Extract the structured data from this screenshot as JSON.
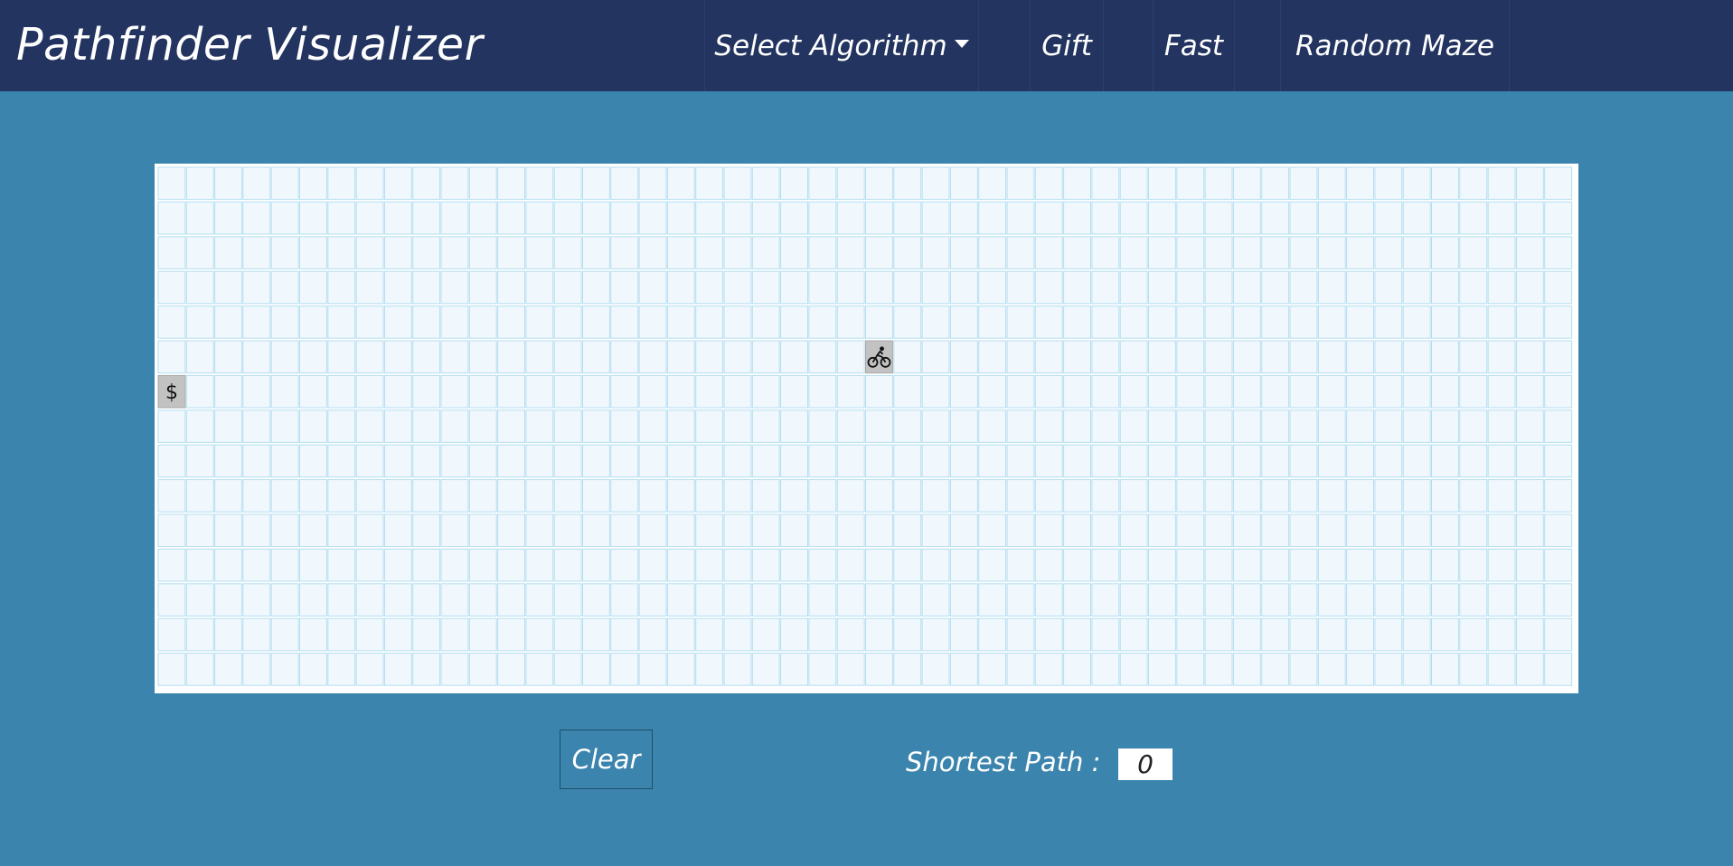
{
  "app": {
    "title": "Pathfinder Visualizer"
  },
  "nav": {
    "select_algorithm": "Select Algorithm",
    "gift": "Gift",
    "fast": "Fast",
    "random_maze": "Random Maze"
  },
  "grid": {
    "rows": 15,
    "cols": 50,
    "start_node": {
      "row": 5,
      "col": 25,
      "icon": "bicycle-icon"
    },
    "target_node": {
      "row": 6,
      "col": 0,
      "icon": "dollar-icon",
      "symbol": "$"
    }
  },
  "controls": {
    "clear_label": "Clear",
    "shortest_path_label": "Shortest Path :",
    "shortest_path_value": "0"
  },
  "colors": {
    "navbar": "#233460",
    "background": "#3b84ad",
    "cell_fill": "#f0f8fd",
    "cell_border": "#b4def0",
    "special_cell": "#c2c2c2"
  }
}
